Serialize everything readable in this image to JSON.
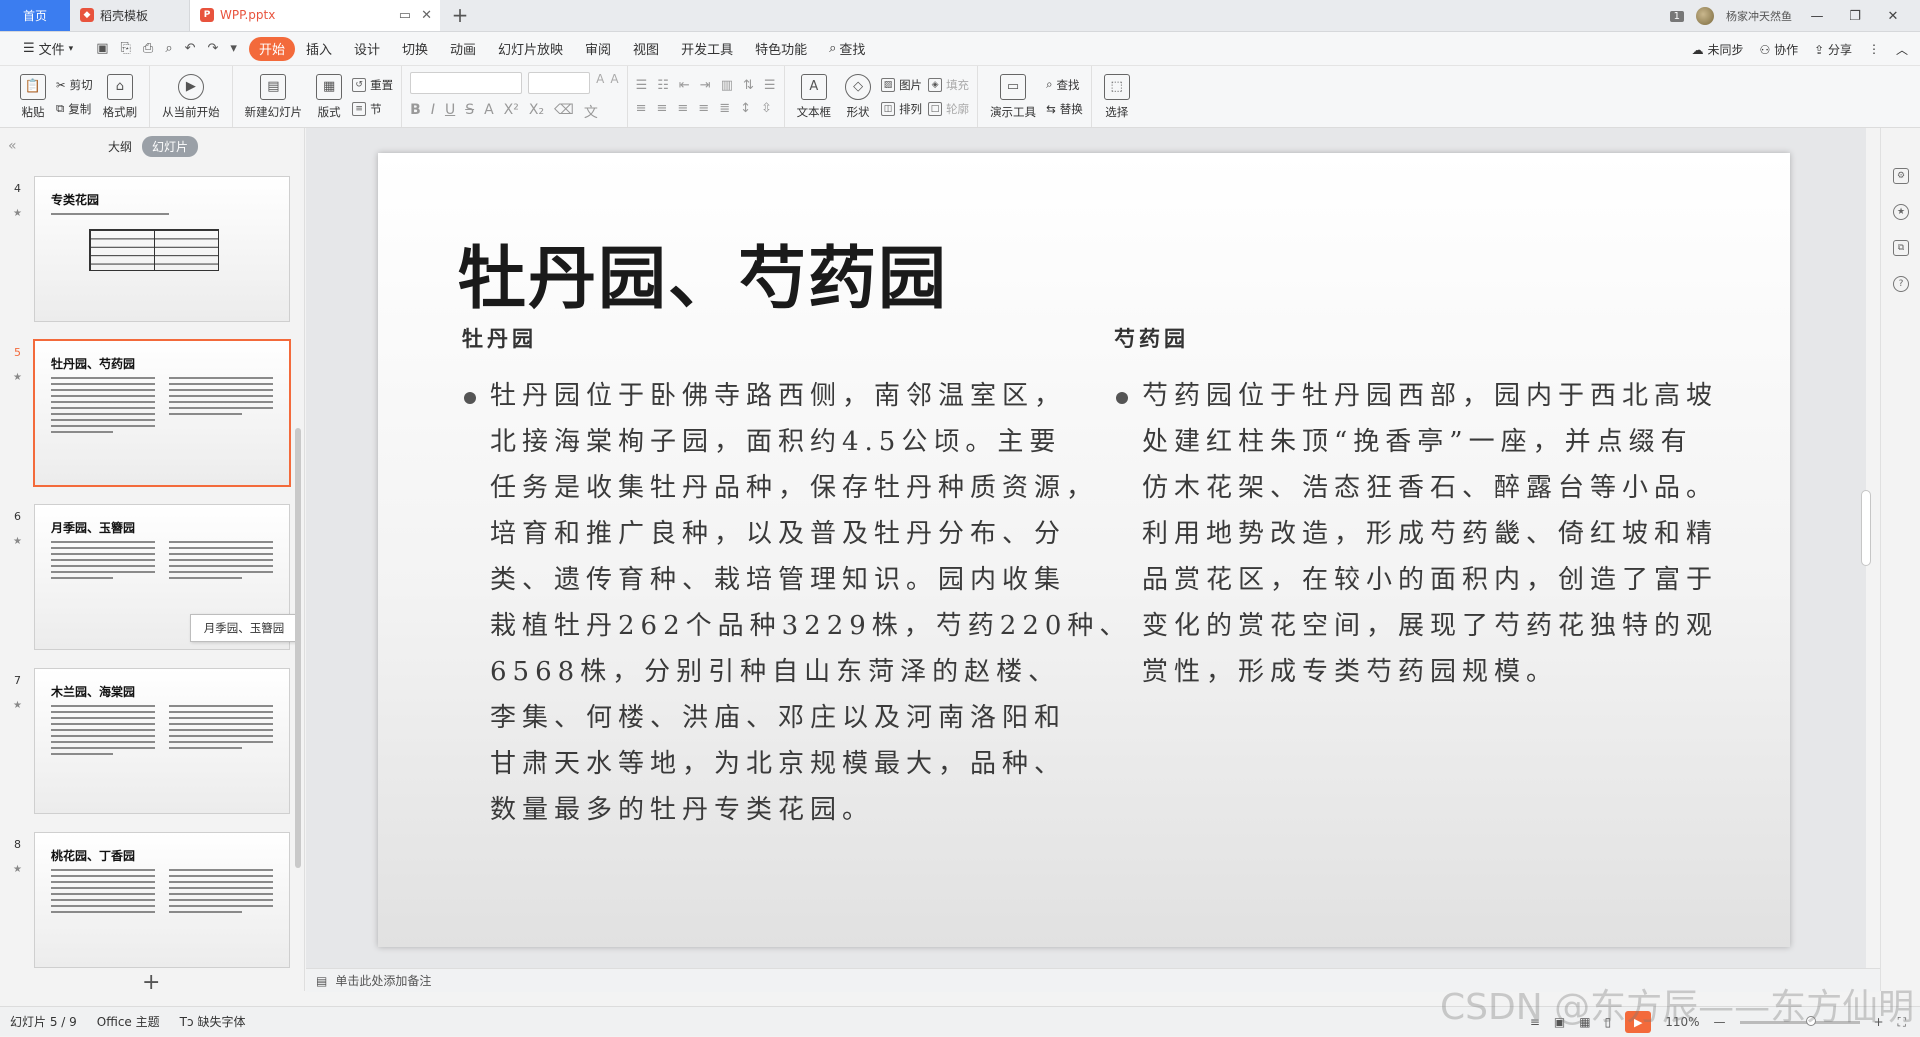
{
  "tabs": {
    "home": "首页",
    "template": "稻壳模板",
    "document": "WPP.pptx",
    "plus": "+"
  },
  "titlebar": {
    "window_count": "1",
    "user": "杨家冲天然鱼",
    "min": "—",
    "restore": "❐",
    "close": "✕"
  },
  "menubar": {
    "file": "文件",
    "items": [
      "开始",
      "插入",
      "设计",
      "切换",
      "动画",
      "幻灯片放映",
      "审阅",
      "视图",
      "开发工具",
      "特色功能"
    ],
    "search": "查找",
    "right": {
      "sync": "未同步",
      "collab": "协作",
      "share": "分享"
    }
  },
  "ribbon": {
    "paste": "粘贴",
    "cut": "剪切",
    "copy": "复制",
    "format_painter": "格式刷",
    "from_current": "从当前开始",
    "new_slide": "新建幻灯片",
    "layout": "版式",
    "reset": "重置",
    "section": "节",
    "textbox": "文本框",
    "shape": "形状",
    "picture": "图片",
    "arrange": "排列",
    "fill": "填充",
    "outline": "轮廓",
    "presentation_tools": "演示工具",
    "find": "查找",
    "replace": "替换",
    "select": "选择"
  },
  "left_panel": {
    "outline": "大纲",
    "slides": "幻灯片",
    "tooltip": "月季园、玉簪园",
    "thumbnails": [
      {
        "num": "4",
        "title": "专类花园"
      },
      {
        "num": "5",
        "title": "牡丹园、芍药园"
      },
      {
        "num": "6",
        "title": "月季园、玉簪园"
      },
      {
        "num": "7",
        "title": "木兰园、海棠园"
      },
      {
        "num": "8",
        "title": "桃花园、丁香园"
      }
    ]
  },
  "slide": {
    "title": "牡丹园、芍药园",
    "left_heading": "牡丹园",
    "left_lines": [
      "牡丹园位于卧佛寺路西侧，南邻温室区，",
      "北接海棠栒子园，面积约4.5公顷。主要",
      "任务是收集牡丹品种，保存牡丹种质资源，",
      "培育和推广良种，以及普及牡丹分布、分",
      "类、遗传育种、栽培管理知识。园内收集",
      "栽植牡丹262个品种3229株，芍药220种、",
      "6568株，分别引种自山东菏泽的赵楼、",
      "李集、何楼、洪庙、邓庄以及河南洛阳和",
      "甘肃天水等地，为北京规模最大，品种、",
      "数量最多的牡丹专类花园。"
    ],
    "right_heading": "芍药园",
    "right_lines": [
      "芍药园位于牡丹园西部，园内于西北高坡",
      "处建红柱朱顶“挽香亭”一座，并点缀有",
      "仿木花架、浩态狂香石、醉露台等小品。",
      "利用地势改造，形成芍药畿、倚红坡和精",
      "品赏花区，在较小的面积内，创造了富于",
      "变化的赏花空间，展现了芍药花独特的观",
      "赏性，形成专类芍药园规模。"
    ]
  },
  "notes_placeholder": "单击此处添加备注",
  "status": {
    "slide_counter": "幻灯片 5 / 9",
    "theme": "Office 主题",
    "missing_font": "缺失字体",
    "zoom": "110%",
    "watermark": "CSDN @东方辰——东方仙明"
  },
  "colors": {
    "accent": "#f36a3b",
    "home_tab": "#3b7df0"
  }
}
